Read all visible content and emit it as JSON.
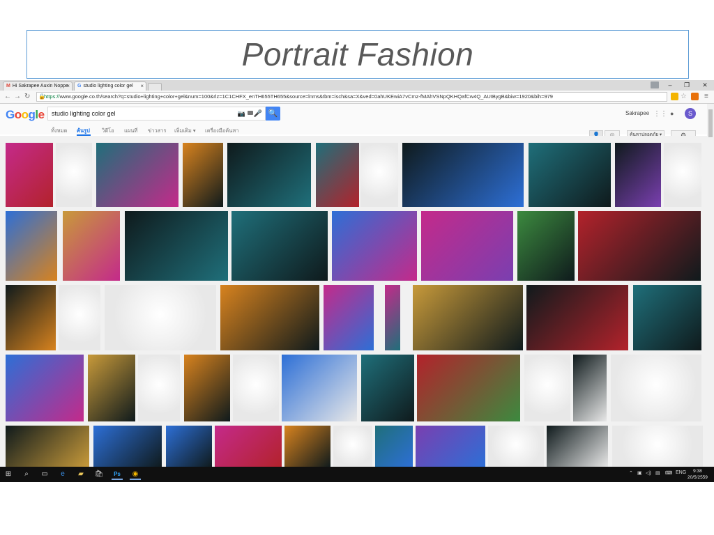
{
  "slide": {
    "title": "Portrait Fashion"
  },
  "browser": {
    "tabs": [
      {
        "label": "Hi Sakrapee Auxin Noppe",
        "favicon": "M",
        "favicon_color": "#db4437"
      },
      {
        "label": "studio lighting color gel",
        "favicon": "G",
        "favicon_color": "#4285f4"
      }
    ],
    "url_https": "https://",
    "url_rest": "www.google.co.th/search?q=studio+lighting+color+gel&num=100&rlz=1C1CHFX_enTH655TH655&source=lnms&tbm=isch&sa=X&ved=0ahUKEwiA7vCmz-fMAhVSNpQKHQafCw4Q_AUIBygB&biw=1920&bih=979"
  },
  "google": {
    "logo": [
      "G",
      "o",
      "o",
      "g",
      "l",
      "e"
    ],
    "query": "studio lighting color gel",
    "user": "Sakrapee",
    "avatar": "S",
    "nav": [
      "ทั้งหมด",
      "ค้นรูป",
      "วิดีโอ",
      "แผนที่",
      "ข่าวสาร",
      "เพิ่มเติม ▾",
      "เครื่องมือค้นหา"
    ],
    "safe_search": "ค้นหาปลอดภัย ▾"
  },
  "taskbar": {
    "lang": "ENG",
    "time": "9:38",
    "date": "20/5/2559"
  },
  "thumbs_palette": {
    "dark": "#0f1a1c",
    "teal": "#1f6f7a",
    "blue": "#2d6fd6",
    "magenta": "#c42a8a",
    "red": "#b3222b",
    "orange": "#d8831e",
    "gold": "#c89a3a",
    "green": "#3c8a3f",
    "diagram": "#e8e8e8",
    "purple": "#7a3fb0"
  }
}
